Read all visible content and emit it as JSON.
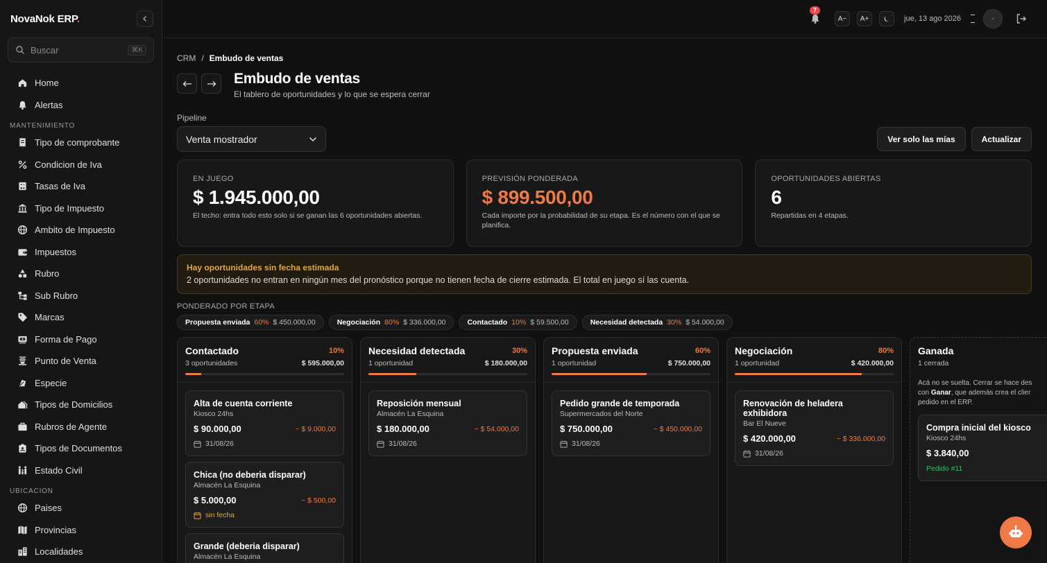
{
  "brand": {
    "name": "NovaNok ERP",
    "dot": "."
  },
  "search": {
    "placeholder": "Buscar",
    "shortcut": "⌘K"
  },
  "nav": {
    "top": [
      {
        "label": "Home",
        "icon": "home-icon"
      },
      {
        "label": "Alertas",
        "icon": "bell-icon"
      }
    ],
    "sections": [
      {
        "title": "MANTENIMIENTO",
        "items": [
          {
            "label": "Tipo de comprobante",
            "icon": "receipt-icon"
          },
          {
            "label": "Condicion de Iva",
            "icon": "percent-icon"
          },
          {
            "label": "Tasas de Iva",
            "icon": "calculator-icon"
          },
          {
            "label": "Tipo de Impuesto",
            "icon": "bank-icon"
          },
          {
            "label": "Ambito de Impuesto",
            "icon": "globe-icon"
          },
          {
            "label": "Impuestos",
            "icon": "wallet-icon"
          },
          {
            "label": "Rubro",
            "icon": "shapes-icon"
          },
          {
            "label": "Sub Rubro",
            "icon": "hierarchy-icon"
          },
          {
            "label": "Marcas",
            "icon": "tag-icon"
          },
          {
            "label": "Forma de Pago",
            "icon": "payment-icon"
          },
          {
            "label": "Punto de Venta",
            "icon": "store-icon"
          },
          {
            "label": "Especie",
            "icon": "leaf-icon"
          },
          {
            "label": "Tipos de Domicilios",
            "icon": "house-icon"
          },
          {
            "label": "Rubros de Agente",
            "icon": "briefcase-icon"
          },
          {
            "label": "Tipos de Documentos",
            "icon": "id-card-icon"
          },
          {
            "label": "Estado Civil",
            "icon": "family-icon"
          }
        ]
      },
      {
        "title": "UBICACION",
        "items": [
          {
            "label": "Paises",
            "icon": "globe-icon"
          },
          {
            "label": "Provincias",
            "icon": "map-icon"
          },
          {
            "label": "Localidades",
            "icon": "city-icon"
          }
        ]
      }
    ]
  },
  "topbar": {
    "notifications": "7",
    "font_smaller": "A−",
    "font_larger": "A+",
    "date": "jue, 13 ago 2026",
    "avatar": "-"
  },
  "breadcrumb": {
    "parent": "CRM",
    "separator": "/",
    "current": "Embudo de ventas"
  },
  "page": {
    "title": "Embudo de ventas",
    "subtitle": "El tablero de oportunidades y lo que se espera cerrar"
  },
  "pipeline": {
    "label": "Pipeline",
    "selected": "Venta mostrador"
  },
  "actions": {
    "mine": "Ver solo las mías",
    "refresh": "Actualizar"
  },
  "kpis": [
    {
      "label": "EN JUEGO",
      "value": "$ 1.945.000,00",
      "desc": "El techo: entra todo esto solo si se ganan las 6 oportunidades abiertas.",
      "accent": false
    },
    {
      "label": "PREVISIÓN PONDERADA",
      "value": "$ 899.500,00",
      "desc": "Cada importe por la probabilidad de su etapa. Es el número con el que se planifica.",
      "accent": true
    },
    {
      "label": "OPORTUNIDADES ABIERTAS",
      "value": "6",
      "desc": "Repartidas en 4 etapas.",
      "accent": false
    }
  ],
  "warning": {
    "title": "Hay oportunidades sin fecha estimada",
    "text": "2 oportunidades no entran en ningún mes del pronóstico porque no tienen fecha de cierre estimada. El total en juego sí las cuenta."
  },
  "weighted": {
    "label": "PONDERADO POR ETAPA",
    "chips": [
      {
        "name": "Propuesta enviada",
        "pct": "60%",
        "amount": "$ 450.000,00"
      },
      {
        "name": "Negociación",
        "pct": "80%",
        "amount": "$ 336.000,00"
      },
      {
        "name": "Contactado",
        "pct": "10%",
        "amount": "$ 59.500,00"
      },
      {
        "name": "Necesidad detectada",
        "pct": "30%",
        "amount": "$ 54.000,00"
      }
    ]
  },
  "columns": [
    {
      "name": "Contactado",
      "pct": "10%",
      "progress": 0.1,
      "count": "3 oportunidades",
      "total": "$ 595.000,00",
      "cards": [
        {
          "title": "Alta de cuenta corriente",
          "client": "Kiosco 24hs",
          "amount": "$ 90.000,00",
          "weighted": "~ $ 9.000,00",
          "date": "31/08/26",
          "nodate": false
        },
        {
          "title": "Chica (no deberia disparar)",
          "client": "Almacén La Esquina",
          "amount": "$ 5.000,00",
          "weighted": "~ $ 500,00",
          "date": "sin fecha",
          "nodate": true
        },
        {
          "title": "Grande (deberia disparar)",
          "client": "Almacén La Esquina",
          "amount": "",
          "weighted": "",
          "date": "",
          "nodate": false
        }
      ]
    },
    {
      "name": "Necesidad detectada",
      "pct": "30%",
      "progress": 0.3,
      "count": "1 oportunidad",
      "total": "$ 180.000,00",
      "cards": [
        {
          "title": "Reposición mensual",
          "client": "Almacén La Esquina",
          "amount": "$ 180.000,00",
          "weighted": "~ $ 54.000,00",
          "date": "31/08/26",
          "nodate": false
        }
      ]
    },
    {
      "name": "Propuesta enviada",
      "pct": "60%",
      "progress": 0.6,
      "count": "1 oportunidad",
      "total": "$ 750.000,00",
      "cards": [
        {
          "title": "Pedido grande de temporada",
          "client": "Supermercados del Norte",
          "amount": "$ 750.000,00",
          "weighted": "~ $ 450.000,00",
          "date": "31/08/26",
          "nodate": false
        }
      ]
    },
    {
      "name": "Negociación",
      "pct": "80%",
      "progress": 0.8,
      "count": "1 oportunidad",
      "total": "$ 420.000,00",
      "cards": [
        {
          "title": "Renovación de heladera exhibidora",
          "client": "Bar El Nueve",
          "amount": "$ 420.000,00",
          "weighted": "~ $ 336.000,00",
          "date": "31/08/26",
          "nodate": false
        }
      ]
    }
  ],
  "won": {
    "name": "Ganada",
    "count": "1 cerrada",
    "note_line1": "Acá no se suelta. Cerrar se hace des",
    "note_pre": "con",
    "note_bold": "Ganar",
    "note_post": ", que además crea el clier",
    "note_line3": "pedido en el ERP.",
    "card": {
      "title": "Compra inicial del kiosco",
      "client": "Kiosco 24hs",
      "amount": "$ 3.840,00",
      "order": "Pedido #11"
    }
  },
  "colors": {
    "accent": "#f07a45",
    "warning": "#e0a845",
    "success": "#3fb96a"
  }
}
